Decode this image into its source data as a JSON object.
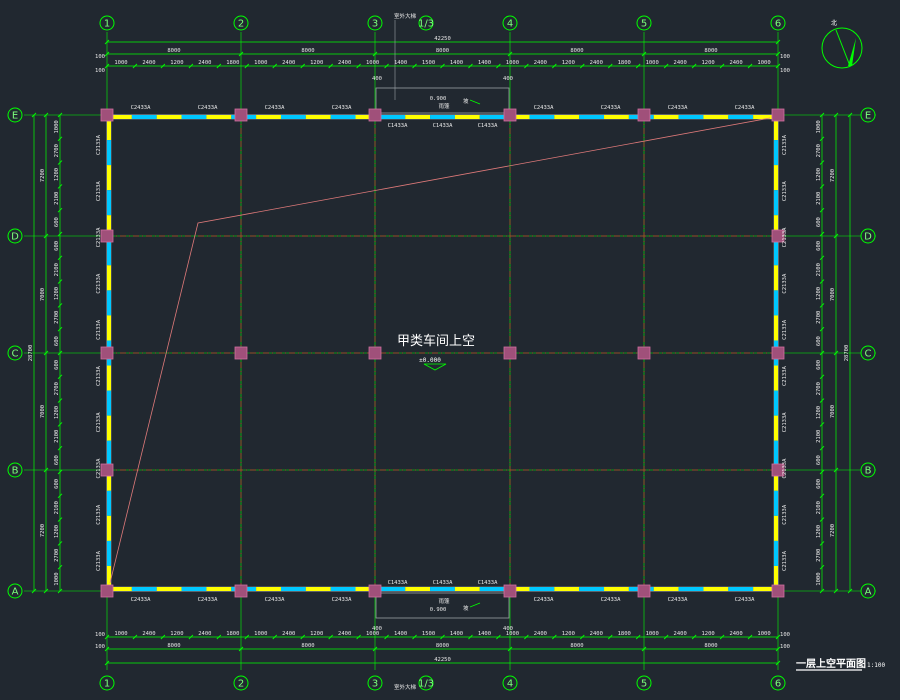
{
  "drawing": {
    "title": "一层上空平面图",
    "scale": "1:100",
    "room_label": "甲类车间上空",
    "level_mark": "±0.000",
    "north_label": "北"
  },
  "axes": {
    "vertical": [
      "1",
      "2",
      "3",
      "4",
      "5",
      "6"
    ],
    "horizontal": [
      "A",
      "B",
      "C",
      "D",
      "E"
    ],
    "sub_axis": "1/3"
  },
  "dims": {
    "top_total": "42250",
    "top_spans": [
      "8000",
      "8000",
      "8000",
      "8000",
      "8000"
    ],
    "top_detail": [
      "1000",
      "2400",
      "1200",
      "2400",
      "1800",
      "1000",
      "2400",
      "1200",
      "2400",
      "1000",
      "1400",
      "1500",
      "1400",
      "1400",
      "1000",
      "2400",
      "1200",
      "2400",
      "1800",
      "1000",
      "2400",
      "1200",
      "2400",
      "1000"
    ],
    "bottom_total": "42250",
    "bottom_spans": [
      "8000",
      "8000",
      "8000",
      "8000",
      "8000"
    ],
    "bottom_detail": [
      "1000",
      "2400",
      "1200",
      "2400",
      "1800",
      "1000",
      "2400",
      "1200",
      "2400",
      "1000",
      "1400",
      "1500",
      "1400",
      "1400",
      "1000",
      "2400",
      "1200",
      "2400",
      "1800",
      "1000",
      "2400",
      "1200",
      "2400",
      "1000"
    ],
    "side_total": "28700",
    "side_spans": [
      "7200",
      "7000",
      "7000",
      "7200"
    ],
    "side_detail": [
      "1000",
      "2700",
      "1200",
      "2100",
      "600",
      "600",
      "2100",
      "1200",
      "2700",
      "600",
      "600",
      "2700",
      "1200",
      "2100",
      "600",
      "600",
      "2100",
      "1200",
      "2700",
      "1000"
    ],
    "edge_offsets": [
      "100",
      "100"
    ],
    "mid_offsets": [
      "400",
      "400"
    ],
    "stair_level": "0.900",
    "stair_label": "室外大梯",
    "stair_top_note": "雨篷",
    "ramp_label": "坡"
  },
  "windows": {
    "top_left": [
      "C2433A",
      "C2433A",
      "C2433A",
      "C2433A"
    ],
    "top_mid": [
      "C1433A",
      "C1433A",
      "C1433A"
    ],
    "top_right": [
      "C2433A",
      "C2433A",
      "C2433A",
      "C2433A"
    ],
    "bottom_left": [
      "C2433A",
      "C2433A",
      "C2433A",
      "C2433A"
    ],
    "bottom_mid": [
      "C1433A",
      "C1433A",
      "C1433A"
    ],
    "bottom_right": [
      "C2433A",
      "C2433A",
      "C2433A",
      "C2433A"
    ],
    "side": "C2133A"
  },
  "colors": {
    "background": "#212830",
    "dimension": "#00ff00",
    "wall": "#ffff00",
    "column": "#a0507a",
    "grid": "#c0392b",
    "window": "#00c8ff"
  }
}
